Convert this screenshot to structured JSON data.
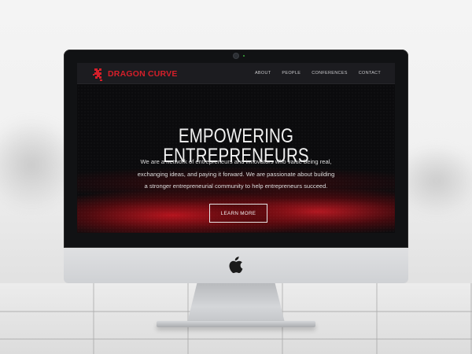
{
  "site": {
    "brand_name": "DRAGON CURVE",
    "brand_color": "#d51f2a",
    "logo_icon": "dragon-curve-icon"
  },
  "nav": {
    "items": [
      {
        "label": "ABOUT"
      },
      {
        "label": "PEOPLE"
      },
      {
        "label": "CONFERENCES"
      },
      {
        "label": "CONTACT"
      }
    ]
  },
  "hero": {
    "title": "EMPOWERING ENTREPRENEURS",
    "lines": [
      "We are a network of entrepreneurs and innovators who value being real,",
      "exchanging ideas, and paying it forward. We are passionate about building",
      "a stronger entrepreneurial community to help entrepreneurs succeed."
    ],
    "cta_label": "LEARN MORE"
  },
  "device": {
    "logo_icon": "apple-icon"
  }
}
